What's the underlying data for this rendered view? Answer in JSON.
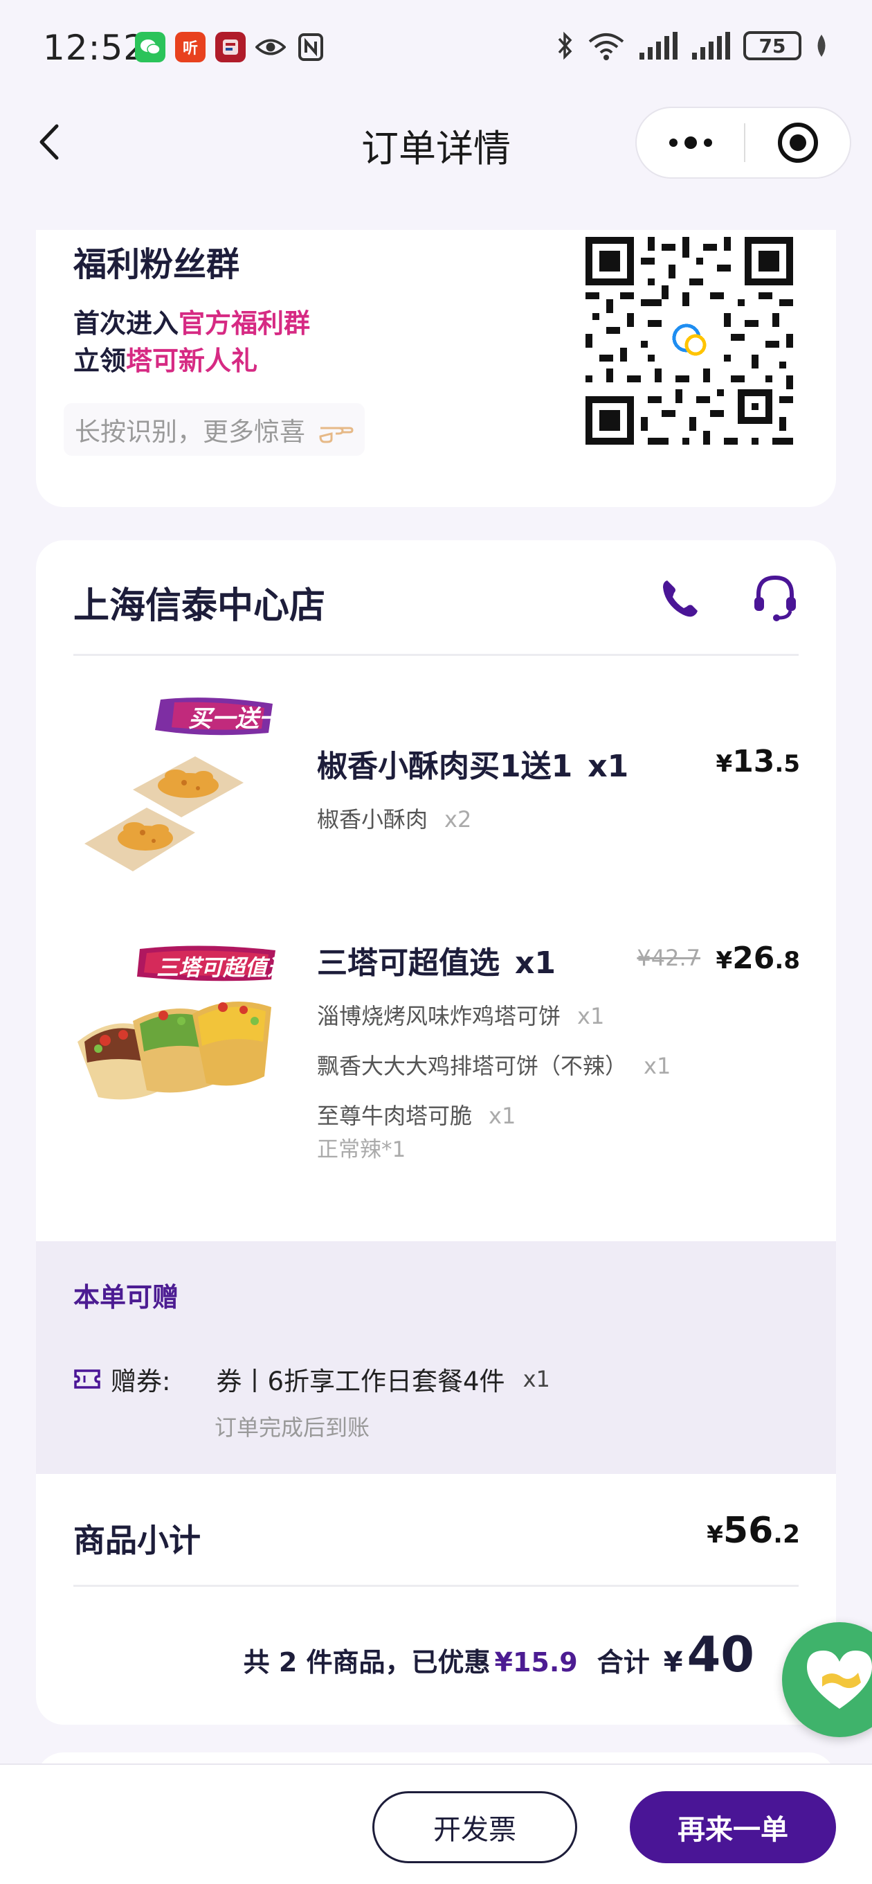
{
  "status_bar": {
    "time": "12:52",
    "notifications": [
      "wechat-icon",
      "listen-app-icon",
      "news-app-icon",
      "eye-icon",
      "nfc-icon"
    ],
    "notif_text_listen": "听",
    "battery": "75"
  },
  "nav": {
    "title": "订单详情"
  },
  "fan_group": {
    "title": "福利粉丝群",
    "line1_prefix": "首次进入",
    "line1_highlight": "官方福利群",
    "line2_prefix": "立领",
    "line2_highlight": "塔可新人礼",
    "hint": "长按识别，更多惊喜"
  },
  "store": {
    "name": "上海信泰中心店"
  },
  "items": [
    {
      "badge": "买一送一",
      "name": "椒香小酥肉买1送1",
      "qty": "x1",
      "price_cur": "¥",
      "price_int": "13",
      "price_dec": ".5",
      "subs": [
        {
          "name": "椒香小酥肉",
          "qty": "x2"
        }
      ]
    },
    {
      "badge": "三塔可超值选",
      "name": "三塔可超值选",
      "qty": "x1",
      "orig_price": "¥42.7",
      "price_cur": "¥",
      "price_int": "26",
      "price_dec": ".8",
      "subs": [
        {
          "name": "淄博烧烤风味炸鸡塔可饼",
          "qty": "x1"
        },
        {
          "name": "飘香大大大鸡排塔可饼（不辣）",
          "qty": "x1"
        },
        {
          "name": "至尊牛肉塔可脆",
          "qty": "x1"
        }
      ],
      "note": "正常辣*1"
    }
  ],
  "gift": {
    "title": "本单可赠",
    "label": "赠券:",
    "value": "券丨6折享工作日套餐4件",
    "qty": "x1",
    "note": "订单完成后到账"
  },
  "subtotal": {
    "label": "商品小计",
    "cur": "¥",
    "int": "56",
    "dec": ".2"
  },
  "summary": {
    "count_text": "共 2 件商品，已优惠",
    "discount": "¥15.9",
    "total_label": "合计",
    "total_cur": "¥",
    "total": "40"
  },
  "actions": {
    "invoice": "开发票",
    "reorder": "再来一单"
  },
  "colors": {
    "brand": "#4a1596",
    "highlight": "#d62a83",
    "float": "#3fb36b"
  }
}
